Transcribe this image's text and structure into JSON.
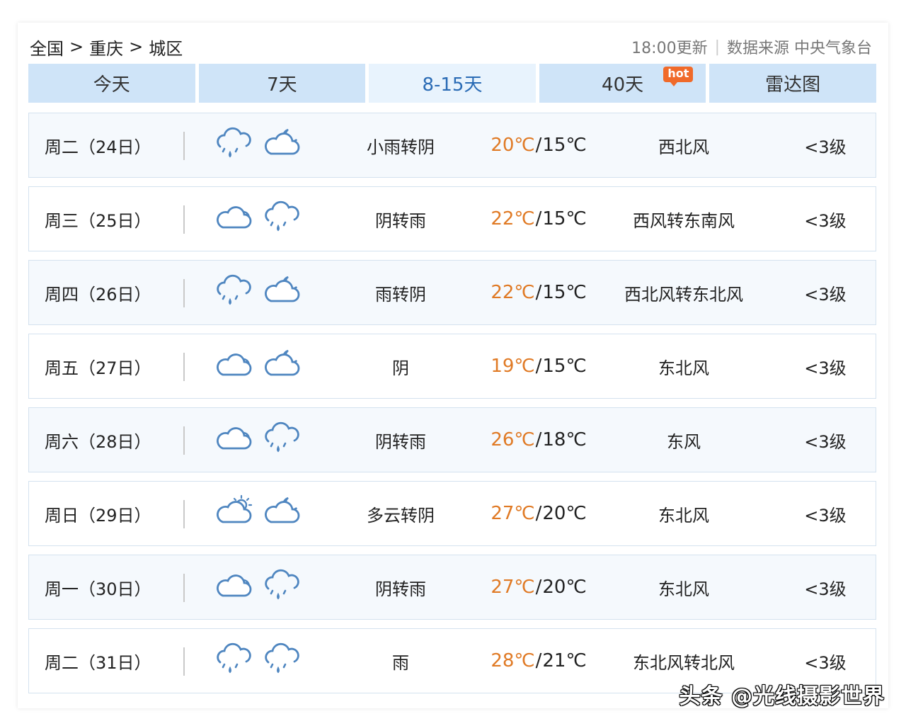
{
  "breadcrumb": {
    "items": [
      "全国",
      "重庆",
      "城区"
    ],
    "separator": ">"
  },
  "meta": {
    "updated": "18:00更新",
    "divider": "|",
    "source": "数据来源 中央气象台"
  },
  "tabs": [
    {
      "label": "今天",
      "active": false
    },
    {
      "label": "7天",
      "active": false
    },
    {
      "label": "8-15天",
      "active": true
    },
    {
      "label": "40天",
      "active": false,
      "badge": "hot"
    },
    {
      "label": "雷达图",
      "active": false
    }
  ],
  "colors": {
    "accent": "#2a6bb5",
    "high_temp": "#e07a25",
    "tab_bg": "#cfe4f8",
    "icon_stroke": "#4f86c0"
  },
  "forecast": [
    {
      "day": "周二（24日）",
      "day_icon": "rain-cloud-icon",
      "night_icon": "cloudy-night-icon",
      "condition": "小雨转阴",
      "high": "20℃",
      "low": "15℃",
      "wind": "西北风",
      "level": "<3级"
    },
    {
      "day": "周三（25日）",
      "day_icon": "overcast-icon",
      "night_icon": "rain-cloud-icon",
      "condition": "阴转雨",
      "high": "22℃",
      "low": "15℃",
      "wind": "西风转东南风",
      "level": "<3级"
    },
    {
      "day": "周四（26日）",
      "day_icon": "rain-cloud-icon",
      "night_icon": "cloudy-night-icon",
      "condition": "雨转阴",
      "high": "22℃",
      "low": "15℃",
      "wind": "西北风转东北风",
      "level": "<3级"
    },
    {
      "day": "周五（27日）",
      "day_icon": "overcast-icon",
      "night_icon": "cloudy-night-icon",
      "condition": "阴",
      "high": "19℃",
      "low": "15℃",
      "wind": "东北风",
      "level": "<3级"
    },
    {
      "day": "周六（28日）",
      "day_icon": "overcast-icon",
      "night_icon": "rain-cloud-icon",
      "condition": "阴转雨",
      "high": "26℃",
      "low": "18℃",
      "wind": "东风",
      "level": "<3级"
    },
    {
      "day": "周日（29日）",
      "day_icon": "partly-cloudy-icon",
      "night_icon": "cloudy-night-icon",
      "condition": "多云转阴",
      "high": "27℃",
      "low": "20℃",
      "wind": "东北风",
      "level": "<3级"
    },
    {
      "day": "周一（30日）",
      "day_icon": "overcast-icon",
      "night_icon": "rain-cloud-icon",
      "condition": "阴转雨",
      "high": "27℃",
      "low": "20℃",
      "wind": "东北风",
      "level": "<3级"
    },
    {
      "day": "周二（31日）",
      "day_icon": "rain-cloud-icon",
      "night_icon": "rain-cloud-icon",
      "condition": "雨",
      "high": "28℃",
      "low": "21℃",
      "wind": "东北风转北风",
      "level": "<3级"
    }
  ],
  "watermark": "头条 @光线摄影世界"
}
